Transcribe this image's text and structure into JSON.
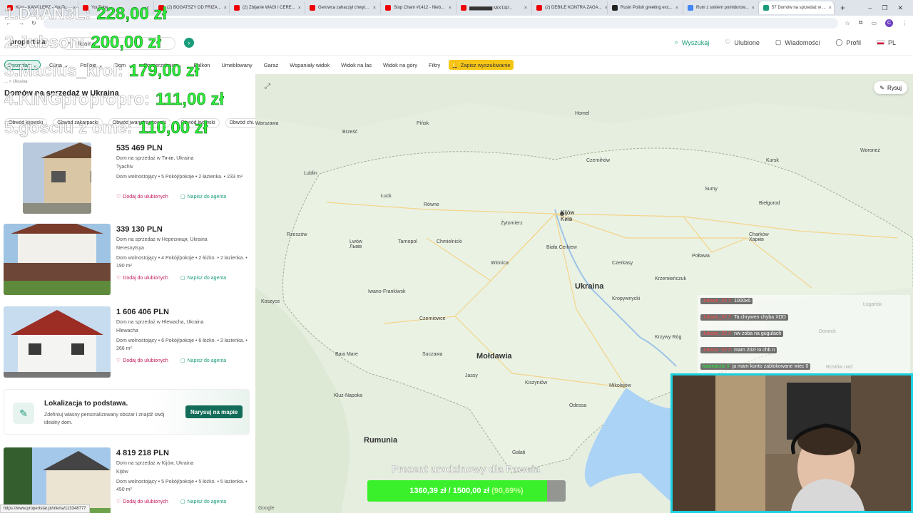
{
  "browser": {
    "tabs": [
      {
        "title": "Kizo - KANCLERZ - YouTu...",
        "color": "#e00"
      },
      {
        "title": "YouTube",
        "color": "#e00"
      },
      {
        "title": "(2) BOGATSZY OD FRIZA...",
        "color": "#e00"
      },
      {
        "title": "(2) Zbijanie WAGI i CERE...",
        "color": "#e00"
      },
      {
        "title": "Gerowca zahaczył chwyt...",
        "color": "#e00"
      },
      {
        "title": "Stop Cham #1412 - Nieb...",
        "color": "#e00"
      },
      {
        "title": "▆▆▆▆▆▆▆ MIXTAP...",
        "color": "#e00"
      },
      {
        "title": "(2) DEBILE KONTRA ZAGA...",
        "color": "#e00"
      },
      {
        "title": "Rusin Polish greeting exc...",
        "color": "#222"
      },
      {
        "title": "Rum z sokiem pomidorow...",
        "color": "#4285f4"
      },
      {
        "title": "57 Domów na sprzedaż w ...",
        "color": "#1a9c7b"
      }
    ],
    "new_tab": "+",
    "window_controls": [
      "–",
      "❐",
      "✕"
    ],
    "avatar_letter": "C"
  },
  "header": {
    "logo": "propertstar",
    "location_value": "Ukraina",
    "nav": {
      "search": "Wyszukaj",
      "favorites": "Ulubione",
      "messages": "Wiadomości",
      "profile": "Profil",
      "language": "PL"
    }
  },
  "filters": {
    "chips": [
      "Sprzedaż",
      "Cena",
      "Pokoje",
      "Dom",
      "Powierzchnia",
      "Balkon",
      "Umeblowany",
      "Garaż",
      "Wspaniały widok",
      "Widok na las",
      "Widok na góry",
      "Filtry"
    ],
    "save_search": "Zapisz wyszukiwanie"
  },
  "results": {
    "breadcrumb": "... > Ukraina",
    "title": "Domów na sprzedaż w Ukraina",
    "regions": [
      "Obwód kijowski",
      "Obwód zakarpacki",
      "Obwód iwanofrankowski",
      "Obwód lwowski",
      "Obwód chi..."
    ],
    "listings": [
      {
        "price": "535 469 PLN",
        "address": "Dom na sprzedaż w Тячів, Ukraina",
        "town": "Tyachiv",
        "desc": "Dom wolnostojący • 5 Pokój/pokoje • 2 łazienka. • 233 m²",
        "fav": "Dodaj do ulubionych",
        "msg": "Napisz do agenta"
      },
      {
        "price": "339 130 PLN",
        "address": "Dom na sprzedaż w Нересниця, Ukraina",
        "town": "Neresnytsya",
        "desc": "Dom wolnostojący • 4 Pokój/pokoje • 2 łóżko. • 2 łazienka. • 190 m²",
        "fav": "Dodaj do ulubionych",
        "msg": "Napisz do agenta"
      },
      {
        "price": "1 606 406 PLN",
        "address": "Dom na sprzedaż w Hlewacha, Ukraina",
        "town": "Hlewacha",
        "desc": "Dom wolnostojący • 6 Pokój/pokoje • 6 łóżko. • 2 łazienka. • 266 m²",
        "fav": "Dodaj do ulubionych",
        "msg": "Napisz do agenta"
      },
      {
        "price": "4 819 218 PLN",
        "address": "Dom na sprzedaż w Kijów, Ukraina",
        "town": "Kijów",
        "desc": "Dom wolnostojący • 5 Pokój/pokoje • 5 łóżko. • 5 łazienka. • 450 m²",
        "fav": "Dodaj do ulubionych",
        "msg": "Napisz do agenta"
      }
    ],
    "promo": {
      "title": "Lokalizacja to podstawa.",
      "text": "Zdefiniuj własny personalizowany obszar i znajdź swój idealny dom.",
      "button": "Narysuj na mapie"
    },
    "status_url": "https://www.propertstar.pl/oferta/113348777"
  },
  "map": {
    "draw_label": "Rysuj",
    "attribution": "Google",
    "labels": [
      {
        "text": "Ukraina",
        "kind": "country"
      },
      {
        "text": "Mołdawia",
        "kind": "country"
      },
      {
        "text": "Rumunia",
        "kind": "country"
      },
      {
        "text": "Kijów\nKиїв",
        "kind": "kyiv"
      },
      {
        "text": "Warszawa",
        "kind": "city"
      },
      {
        "text": "Lublin",
        "kind": "city"
      },
      {
        "text": "Lwów\nЛьвів",
        "kind": "city"
      },
      {
        "text": "Żytomierz",
        "kind": "city"
      },
      {
        "text": "Winnica",
        "kind": "city"
      },
      {
        "text": "Czerkasy",
        "kind": "city"
      },
      {
        "text": "Połtawa",
        "kind": "city"
      },
      {
        "text": "Charków\nХарків",
        "kind": "city"
      },
      {
        "text": "Kiszyniów",
        "kind": "city"
      },
      {
        "text": "Odessa",
        "kind": "city"
      },
      {
        "text": "Mikołajów",
        "kind": "city"
      },
      {
        "text": "Krzywy Róg",
        "kind": "city"
      },
      {
        "text": "Czerniowce",
        "kind": "city"
      },
      {
        "text": "Tarnopol",
        "kind": "city"
      },
      {
        "text": "Równe",
        "kind": "city"
      },
      {
        "text": "Łuck",
        "kind": "city"
      },
      {
        "text": "Brześć",
        "kind": "city"
      },
      {
        "text": "Pińsk",
        "kind": "city"
      },
      {
        "text": "Homel",
        "kind": "city"
      },
      {
        "text": "Czernihów",
        "kind": "city"
      },
      {
        "text": "Sumy",
        "kind": "city"
      },
      {
        "text": "Biełgorod",
        "kind": "city"
      },
      {
        "text": "Kursk",
        "kind": "city"
      },
      {
        "text": "Woroneż",
        "kind": "city"
      },
      {
        "text": "Rzeszów",
        "kind": "city"
      },
      {
        "text": "Iwano-Frankiwsk",
        "kind": "city"
      },
      {
        "text": "Chmielnicki",
        "kind": "city"
      },
      {
        "text": "Biała Cerkiew",
        "kind": "city"
      },
      {
        "text": "Krzemieńczuk",
        "kind": "city"
      },
      {
        "text": "Kropywnycki",
        "kind": "city"
      },
      {
        "text": "Suczawa",
        "kind": "city"
      },
      {
        "text": "Jassy",
        "kind": "city"
      },
      {
        "text": "Baia Mare",
        "kind": "city"
      },
      {
        "text": "Kluż-Napoka",
        "kind": "city"
      },
      {
        "text": "Koszyce",
        "kind": "city"
      },
      {
        "text": "Galați",
        "kind": "city"
      },
      {
        "text": "Doneck",
        "kind": "city"
      },
      {
        "text": "Ługańsk",
        "kind": "city"
      },
      {
        "text": "Rostów nad",
        "kind": "city"
      }
    ]
  },
  "stream": {
    "leaderboard": [
      {
        "name": "1.D4AN3L:",
        "amount": "228,00 zł"
      },
      {
        "name": "2.Jubson:",
        "amount": "200,00 zł"
      },
      {
        "name": "3.Macius_krol:",
        "amount": "179,00 zł"
      },
      {
        "name": "4.KINGpropropro:",
        "amount": "111,00 zł"
      },
      {
        "name": "5.gosciu z ome:",
        "amount": "110,00 zł"
      }
    ],
    "chat": [
      {
        "user": "Jubson_02 //",
        "text": "1000x6",
        "green": false
      },
      {
        "user": "Jubson_02 //",
        "text": "Ta chrywen chyba XDD",
        "green": false
      },
      {
        "user": "Jubson_02 //",
        "text": "nw zoba na gugulach",
        "green": false
      },
      {
        "user": "Jubson_02 //",
        "text": "mam 20zł to chb n",
        "green": false
      },
      {
        "user": "kasmarztv //",
        "text": "ja mam konto zablokowane wiec 0",
        "green": true
      }
    ],
    "goal": {
      "title": "Prezent urodzinowy dla Pawcia",
      "current": "1360,39 zł",
      "separator": "/",
      "target": "1500,00 zł",
      "percent_label": "(90,69%)",
      "progress": 0.9069
    }
  }
}
